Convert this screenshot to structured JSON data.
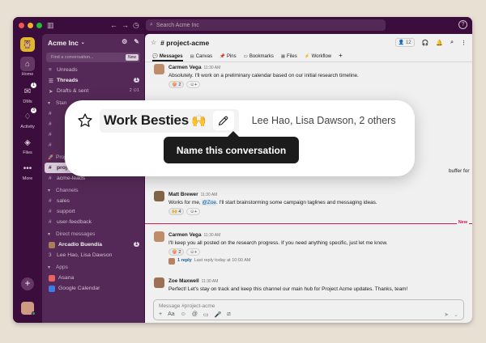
{
  "titlebar": {
    "search_placeholder": "Search Acme Inc"
  },
  "rail": {
    "items": [
      {
        "label": "Home",
        "icon": "home-icon"
      },
      {
        "label": "DMs",
        "icon": "dm-icon",
        "badge": "1"
      },
      {
        "label": "Activity",
        "icon": "bell-icon",
        "badge": "3"
      },
      {
        "label": "Files",
        "icon": "files-icon"
      },
      {
        "label": "More",
        "icon": "more-icon"
      }
    ]
  },
  "sidebar": {
    "workspace": "Acme Inc",
    "find_placeholder": "Find a conversation...",
    "find_tag": "New",
    "top": [
      {
        "label": "Unreads",
        "bold": false
      },
      {
        "label": "Threads",
        "bold": true,
        "count": "1"
      },
      {
        "label": "Drafts & sent",
        "bold": false,
        "count_plain": "2 ⊙1"
      }
    ],
    "starred_label": "Stan",
    "starred": [
      "#",
      "#",
      "#",
      "#"
    ],
    "project_section": "Project Acme",
    "project_channels": [
      {
        "label": "project-acme",
        "active": true
      },
      {
        "label": "acme-leads",
        "active": false
      }
    ],
    "channels_section": "Channels",
    "channels": [
      "sales",
      "support",
      "user-feedback"
    ],
    "dm_section": "Direct messages",
    "dms": [
      {
        "label": "Arcadio Buendía",
        "count": "1"
      },
      {
        "label": "Lee Hao, Lisa Dawson"
      }
    ],
    "apps_section": "Apps",
    "apps": [
      "Asana",
      "Google Calendar"
    ]
  },
  "channel": {
    "name": "project-acme",
    "member_count": "12",
    "tabs": [
      "Messages",
      "Canvas",
      "Pins",
      "Bookmarks",
      "Files",
      "Workflow"
    ]
  },
  "messages": [
    {
      "name": "Carmen Vega",
      "time": "11:30 AM",
      "text": "Absolutely. I'll work on a preliminary calendar based on our initial research timeline.",
      "reaction": "🍿 2"
    },
    {
      "name": "",
      "time": "",
      "text_partial": "buffer for"
    },
    {
      "name": "Matt Brewer",
      "time": "11:30 AM",
      "text_before": "Works for me, ",
      "mention": "@Zoe",
      "text_after": ". I'll start brainstorming some campaign taglines and messaging ideas.",
      "reaction": "🙌 4"
    },
    {
      "name": "Carmen Vega",
      "time": "11:30 AM",
      "text": "I'll keep you all posted on the research progress. If you need anything specific, just let me know.",
      "reaction": "🍿 2",
      "thread_reply": "1 reply",
      "thread_last": "Last reply today at 10:00 AM"
    },
    {
      "name": "Zoe Maxwell",
      "time": "11:30 AM",
      "text": "Perfect! Let's stay on track and keep this channel our main hub for Project Acme updates. Thanks, team!"
    }
  ],
  "new_marker": "New",
  "composer": {
    "placeholder": "Message #project-acme"
  },
  "popup": {
    "conversation_name": "Work Besties",
    "emoji": "🙌",
    "participants": "Lee Hao, Lisa Dawson, 2 others",
    "tooltip": "Name this conversation"
  },
  "colors": {
    "aubergine": "#3f0e40",
    "sidebar": "#5b2c5d",
    "new_red": "#e01e5a",
    "link": "#1264a3"
  }
}
